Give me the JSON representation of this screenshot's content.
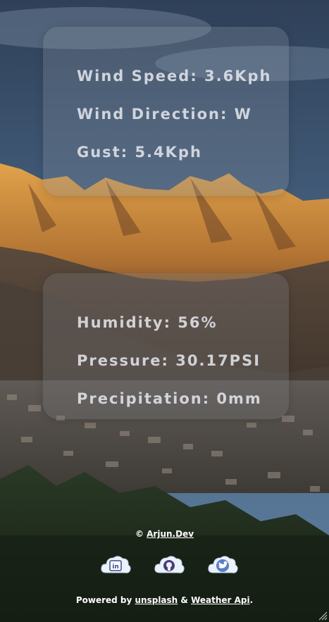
{
  "wind": {
    "speed_label": "Wind Speed:",
    "speed_value": "3.6Kph",
    "direction_label": "Wind Direction:",
    "direction_value": "W",
    "gust_label": "Gust:",
    "gust_value": "5.4Kph"
  },
  "atmosphere": {
    "humidity_label": "Humidity:",
    "humidity_value": "56%",
    "pressure_label": "Pressure:",
    "pressure_value": "30.17PSI",
    "precip_label": "Precipitation:",
    "precip_value": "0mm"
  },
  "footer": {
    "copyright_symbol": "©",
    "author_link": "Arjun.Dev",
    "powered_prefix": "Powered by",
    "unsplash_link": "unsplash",
    "ampersand": "&",
    "weather_link": "Weather Api",
    "period": "."
  },
  "social": [
    {
      "icon": "linkedin-icon"
    },
    {
      "icon": "github-icon"
    },
    {
      "icon": "twitter-icon"
    }
  ],
  "colors": {
    "sky": "#3e5a78",
    "mountain_lit": "#c98a3a",
    "mountain_shadow": "#4a3a2e",
    "forest": "#1f2e1e",
    "card_text": "#e1e4eb"
  }
}
